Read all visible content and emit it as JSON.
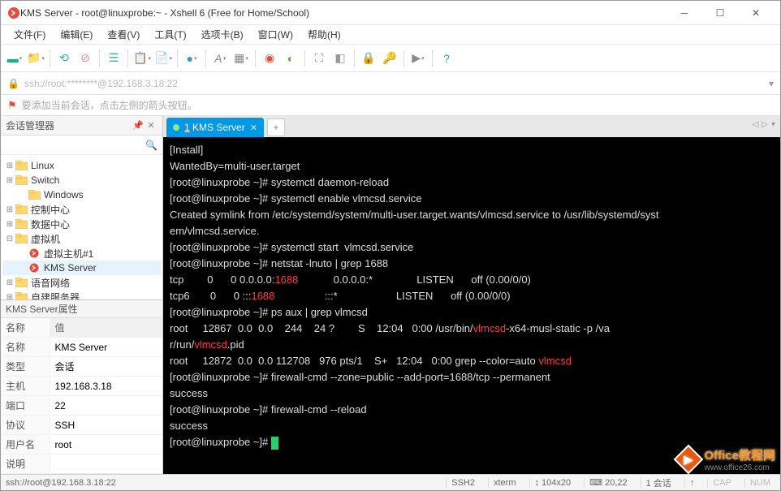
{
  "window": {
    "title": "KMS Server - root@linuxprobe:~ - Xshell 6 (Free for Home/School)"
  },
  "menu": {
    "file": "文件(F)",
    "edit": "编辑(E)",
    "view": "查看(V)",
    "tools": "工具(T)",
    "tabs": "选项卡(B)",
    "window": "窗口(W)",
    "help": "帮助(H)"
  },
  "addr": {
    "url": "ssh://root:********@192.168.3.18:22"
  },
  "hint": {
    "text": "要添加当前会话，点击左侧的箭头按钮。"
  },
  "session_panel": {
    "title": "会话管理器"
  },
  "tree": {
    "items": [
      {
        "label": "Linux",
        "d": 0,
        "exp": "+",
        "type": "f"
      },
      {
        "label": "Switch",
        "d": 0,
        "exp": "+",
        "type": "f"
      },
      {
        "label": "Windows",
        "d": 1,
        "exp": "",
        "type": "f"
      },
      {
        "label": "控制中心",
        "d": 0,
        "exp": "+",
        "type": "f"
      },
      {
        "label": "数据中心",
        "d": 0,
        "exp": "+",
        "type": "f"
      },
      {
        "label": "虚拟机",
        "d": 0,
        "exp": "-",
        "type": "f"
      },
      {
        "label": "虚拟主机#1",
        "d": 1,
        "exp": "",
        "type": "s"
      },
      {
        "label": "KMS Server",
        "d": 1,
        "exp": "",
        "type": "s",
        "sel": true
      },
      {
        "label": "语音网络",
        "d": 0,
        "exp": "+",
        "type": "f"
      },
      {
        "label": "自建服务器",
        "d": 0,
        "exp": "+",
        "type": "f"
      }
    ]
  },
  "props": {
    "title": "KMS Server属性",
    "col1": "名称",
    "col2": "值",
    "rows": [
      {
        "k": "名称",
        "v": "KMS Server"
      },
      {
        "k": "类型",
        "v": "会话"
      },
      {
        "k": "主机",
        "v": "192.168.3.18"
      },
      {
        "k": "端口",
        "v": "22"
      },
      {
        "k": "协议",
        "v": "SSH"
      },
      {
        "k": "用户名",
        "v": "root"
      },
      {
        "k": "说明",
        "v": ""
      }
    ]
  },
  "tab": {
    "num": "1",
    "label": "KMS Server"
  },
  "term": {
    "lines": [
      {
        "t": ""
      },
      {
        "t": "[Install]"
      },
      {
        "t": "WantedBy=multi-user.target"
      },
      {
        "t": "[root@linuxprobe ~]# systemctl daemon-reload"
      },
      {
        "t": "[root@linuxprobe ~]# systemctl enable vlmcsd.service"
      },
      {
        "t": "Created symlink from /etc/systemd/system/multi-user.target.wants/vlmcsd.service to /usr/lib/systemd/syst"
      },
      {
        "t": "em/vlmcsd.service."
      },
      {
        "t": "[root@linuxprobe ~]# systemctl start  vlmcsd.service"
      },
      {
        "t": "[root@linuxprobe ~]# netstat -lnuto | grep 1688"
      },
      {
        "seg": [
          {
            "t": "tcp        0      0 0.0.0.0:"
          },
          {
            "t": "1688",
            "c": "red"
          },
          {
            "t": "            0.0.0.0:*               LISTEN      off (0.00/0/0)"
          }
        ]
      },
      {
        "seg": [
          {
            "t": "tcp6       0      0 :::"
          },
          {
            "t": "1688",
            "c": "red"
          },
          {
            "t": "                 :::*                    LISTEN      off (0.00/0/0)"
          }
        ]
      },
      {
        "t": "[root@linuxprobe ~]# ps aux | grep vlmcsd"
      },
      {
        "seg": [
          {
            "t": "root     12867  0.0  0.0    244    24 ?        S    12:04   0:00 /usr/bin/"
          },
          {
            "t": "vlmcsd",
            "c": "red"
          },
          {
            "t": "-x64-musl-static -p /va"
          }
        ]
      },
      {
        "seg": [
          {
            "t": "r/run/"
          },
          {
            "t": "vlmcsd",
            "c": "red"
          },
          {
            "t": ".pid"
          }
        ]
      },
      {
        "seg": [
          {
            "t": "root     12872  0.0  0.0 112708   976 pts/1    S+   12:04   0:00 grep --color=auto "
          },
          {
            "t": "vlmcsd",
            "c": "red"
          }
        ]
      },
      {
        "t": "[root@linuxprobe ~]# firewall-cmd --zone=public --add-port=1688/tcp --permanent"
      },
      {
        "t": "success"
      },
      {
        "t": "[root@linuxprobe ~]# firewall-cmd --reload"
      },
      {
        "t": "success"
      },
      {
        "seg": [
          {
            "t": "[root@linuxprobe ~]# "
          }
        ],
        "cursor": true
      }
    ]
  },
  "status": {
    "conn": "ssh://root@192.168.3.18:22",
    "s1": "SSH2",
    "s2": "xterm",
    "s3": "↕ 104x20",
    "s4": "⌨ 20,22",
    "s5": "1 会话",
    "s6": "↑",
    "s7": "CAP",
    "s8": "NUM"
  },
  "watermark": {
    "t1": "Office教程网",
    "t2": "www.office26.com"
  }
}
